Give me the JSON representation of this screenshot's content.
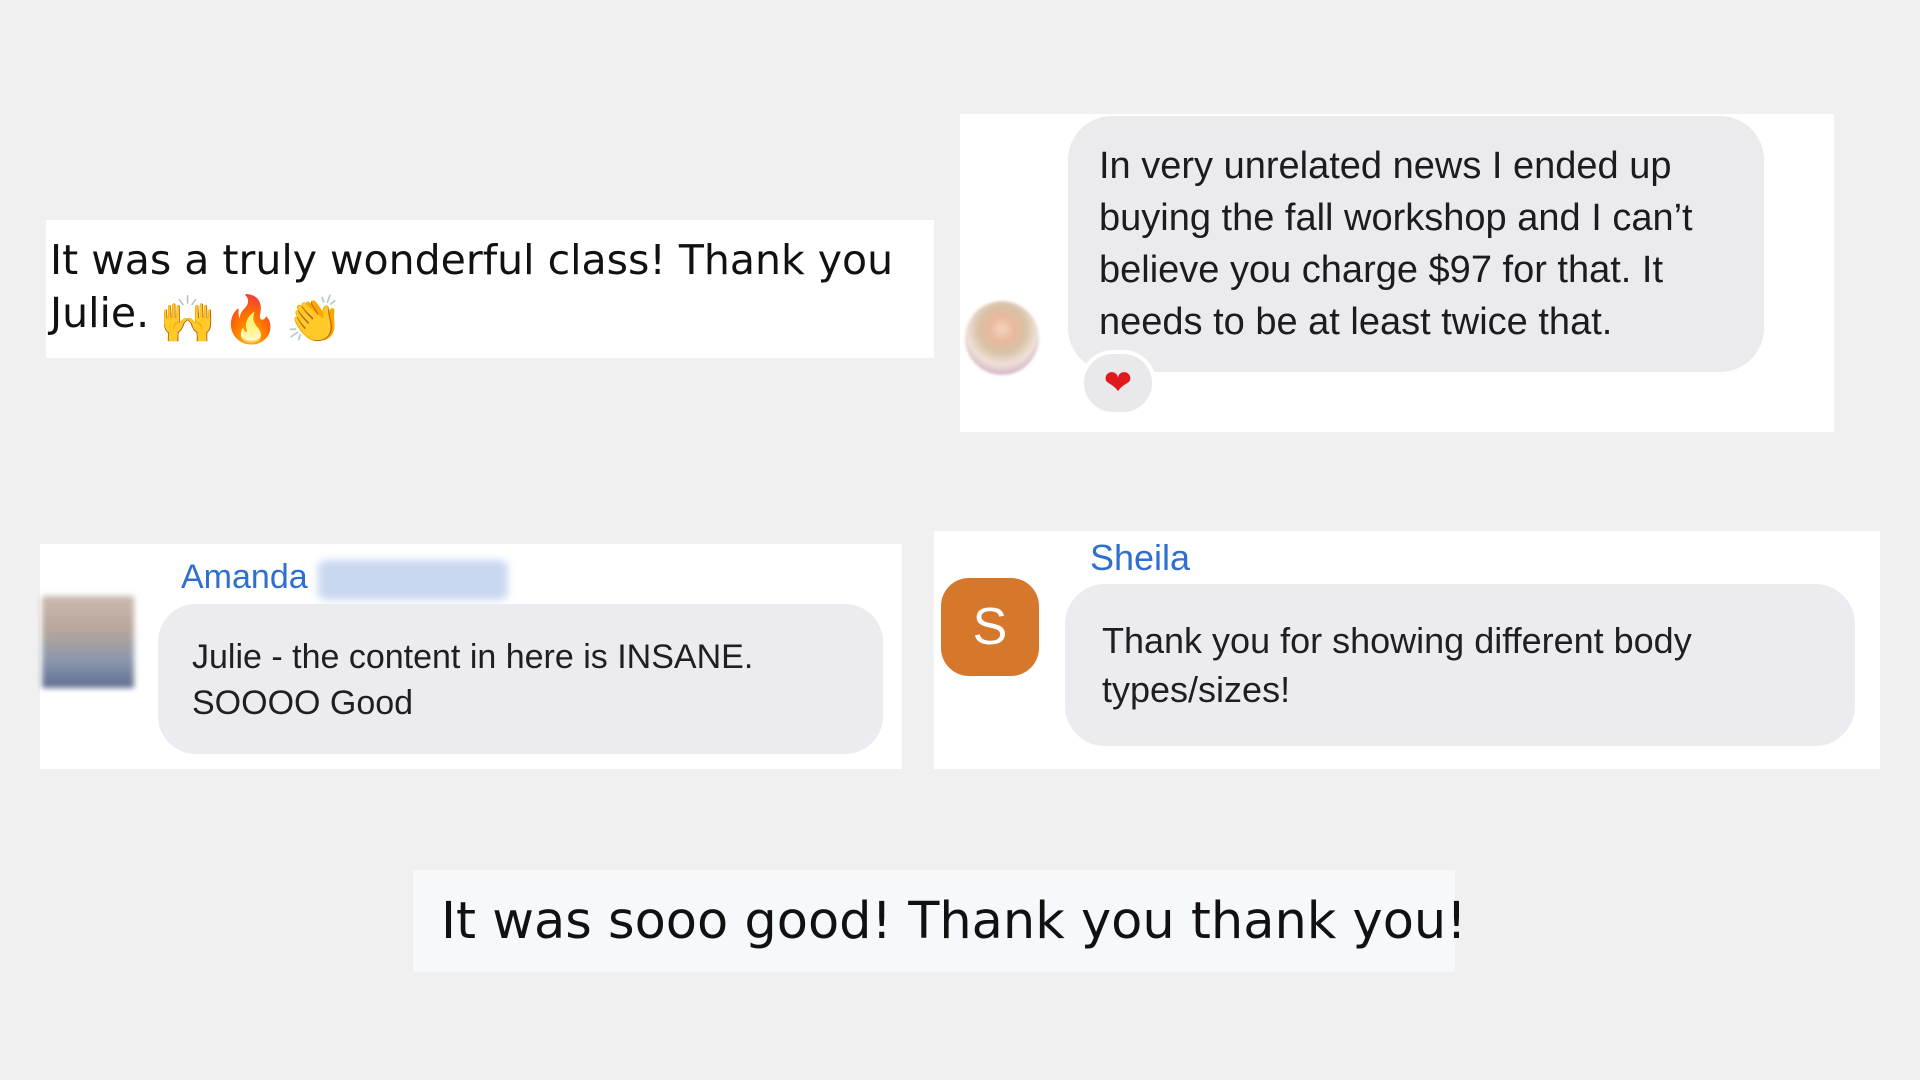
{
  "card_1": {
    "message": "It was a truly wonderful class! Thank you\nJulie.",
    "emojis": [
      "🙌",
      "🔥",
      "👏"
    ]
  },
  "card_2": {
    "message": "In very unrelated news I ended up buying the fall workshop and I can’t believe you charge $97 for that. It needs to be at least twice that.",
    "reaction": "❤"
  },
  "card_3": {
    "name": "Amanda",
    "message": "Julie - the content in here is INSANE. SOOOO Good"
  },
  "card_4": {
    "avatar_initial": "S",
    "name": "Sheila",
    "message": "Thank you for showing different body types/sizes!",
    "avatar_color": "#d6782c"
  },
  "card_5": {
    "message": "It was sooo good! Thank you thank you!"
  },
  "colors": {
    "background": "#f0f0f0",
    "name_link": "#2f6fcf",
    "bubble": "#ebebf0"
  }
}
